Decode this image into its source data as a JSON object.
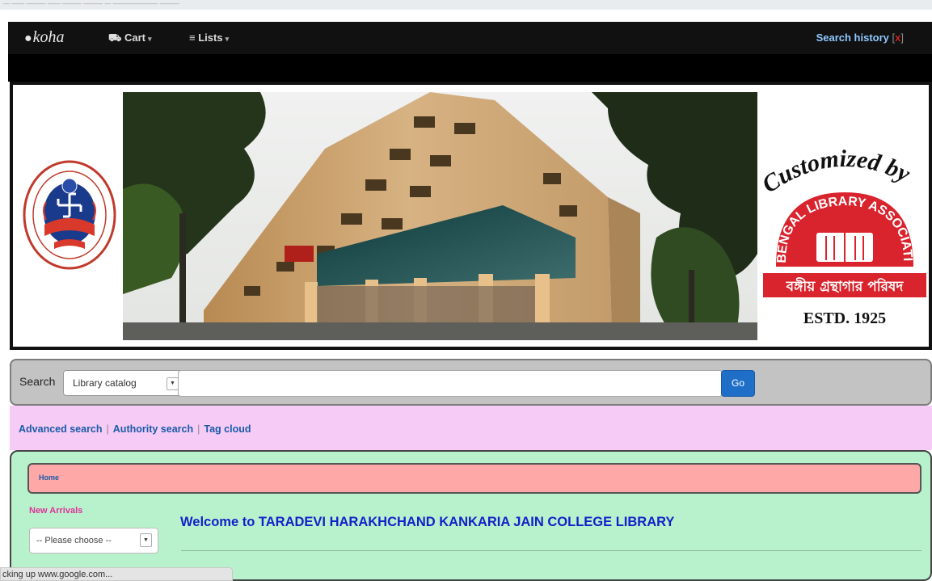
{
  "browser": {
    "top_strip_text": "— —— ——— —— ——— ——— — ——————— ———"
  },
  "navbar": {
    "logo_text": "koha",
    "cart_label": "Cart",
    "lists_label": "Lists",
    "search_history_label": "Search history",
    "search_history_clear": "x"
  },
  "banner": {
    "logo_text_top": "Customized by",
    "logo_org": "BENGAL LIBRARY ASSOCIATION",
    "logo_bengali": "বঙ্গীয় গ্রন্থাগার পরিষদ",
    "logo_estd": "ESTD. 1925"
  },
  "search": {
    "label": "Search",
    "scope_selected": "Library catalog",
    "query_value": "",
    "go_label": "Go"
  },
  "more_searches": {
    "advanced": "Advanced search",
    "authority": "Authority search",
    "tag_cloud": "Tag cloud"
  },
  "breadcrumb": {
    "home": "Home"
  },
  "new_arrivals": {
    "label": "New Arrivals",
    "selected": "-- Please choose --"
  },
  "main": {
    "welcome_text": "Welcome to TARADEVI HARAKHCHAND KANKARIA JAIN COLLEGE LIBRARY"
  },
  "status_bar": {
    "text": "cking up www.google.com..."
  },
  "colors": {
    "navbar": "#111111",
    "search_bg": "#c3c3c3",
    "links_bg": "#f6ccf6",
    "main_bg": "#b8f2cc",
    "breadcrumb_bg": "#fea8a8",
    "welcome": "#1420c9",
    "go_button": "#1f6fc9"
  }
}
